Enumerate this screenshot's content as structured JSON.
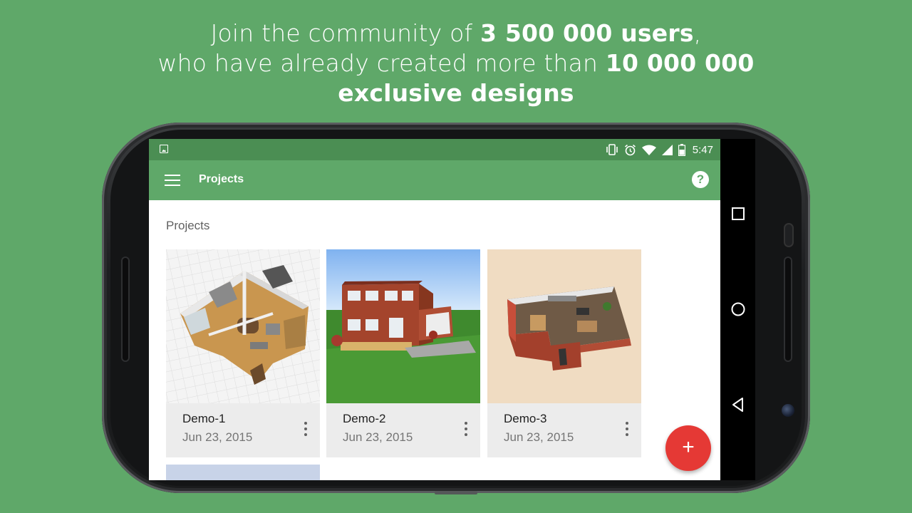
{
  "headline": {
    "line1_a": "Join the community of ",
    "line1_b": "3 500 000 users",
    "line1_c": ",",
    "line2_a": "who have already created more than ",
    "line2_b": "10 000 000",
    "line3": "exclusive designs"
  },
  "statusbar": {
    "time": "5:47",
    "icons": [
      "image-icon",
      "vibrate-icon",
      "alarm-icon",
      "wifi-icon",
      "signal-icon",
      "battery-icon"
    ]
  },
  "appbar": {
    "title": "Projects",
    "menu_icon": "menu-icon",
    "help_icon": "help-icon"
  },
  "section_title": "Projects",
  "projects": [
    {
      "name": "Demo-1",
      "date": "Jun 23, 2015"
    },
    {
      "name": "Demo-2",
      "date": "Jun 23, 2015"
    },
    {
      "name": "Demo-3",
      "date": "Jun 23, 2015"
    }
  ],
  "fab": {
    "label": "+"
  },
  "navbar": {
    "icons": [
      "recents-icon",
      "home-icon",
      "back-icon"
    ]
  },
  "colors": {
    "background": "#5fa869",
    "statusbar": "#4b8e53",
    "appbar": "#5fa869",
    "fab": "#e53935"
  }
}
